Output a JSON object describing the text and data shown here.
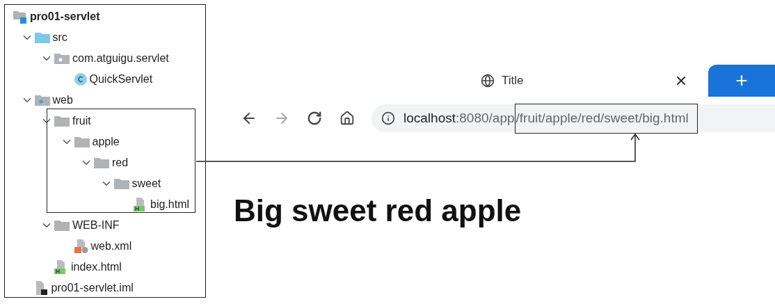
{
  "project_tree": {
    "root": {
      "label": "pro01-servlet",
      "kind": "project",
      "children": [
        {
          "label": "src",
          "kind": "source-folder",
          "expanded": true,
          "children": [
            {
              "label": "com.atguigu.servlet",
              "kind": "package",
              "expanded": true,
              "children": [
                {
                  "label": "QuickServlet",
                  "kind": "class"
                }
              ]
            }
          ]
        },
        {
          "label": "web",
          "kind": "web-folder",
          "expanded": true,
          "children": [
            {
              "label": "fruit",
              "kind": "folder",
              "expanded": true,
              "children": [
                {
                  "label": "apple",
                  "kind": "folder",
                  "expanded": true,
                  "children": [
                    {
                      "label": "red",
                      "kind": "folder",
                      "expanded": true,
                      "children": [
                        {
                          "label": "sweet",
                          "kind": "folder",
                          "expanded": true,
                          "children": [
                            {
                              "label": "big.html",
                              "kind": "html"
                            }
                          ]
                        }
                      ]
                    }
                  ]
                }
              ]
            },
            {
              "label": "WEB-INF",
              "kind": "folder",
              "expanded": true,
              "children": [
                {
                  "label": "web.xml",
                  "kind": "xml"
                }
              ]
            },
            {
              "label": "index.html",
              "kind": "html"
            }
          ]
        },
        {
          "label": "pro01-servlet.iml",
          "kind": "iml"
        }
      ]
    }
  },
  "browser": {
    "tab": {
      "title": "Title",
      "selected": true
    },
    "new_tab": "+",
    "address": {
      "host": "localhost",
      "path": ":8080/app",
      "highlighted_path": "/fruit/apple/red/sweet/big.html"
    },
    "page_heading": "Big sweet red apple"
  }
}
